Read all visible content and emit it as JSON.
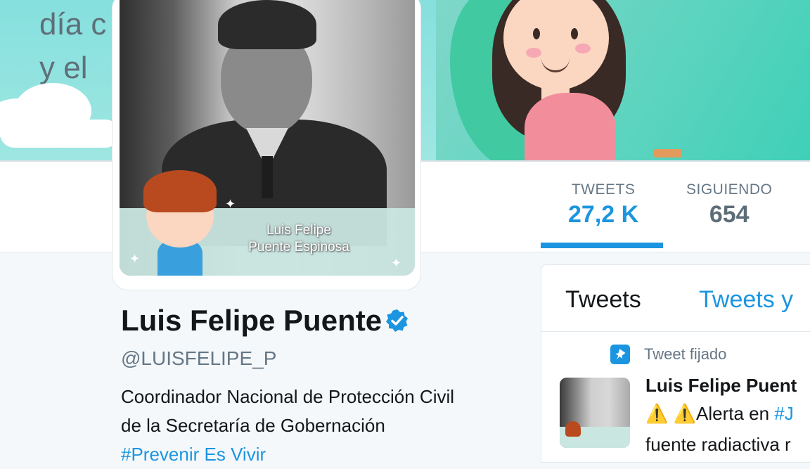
{
  "banner": {
    "text_line1": "día c",
    "text_line2": "y el"
  },
  "avatar": {
    "caption_line1": "Luis Felipe",
    "caption_line2": "Puente Espinosa"
  },
  "stats": [
    {
      "label": "TWEETS",
      "value": "27,2 K"
    },
    {
      "label": "SIGUIENDO",
      "value": "654"
    }
  ],
  "profile": {
    "name": "Luis Felipe Puente",
    "handle": "@LUISFELIPE_P",
    "bio_line1": "Coordinador Nacional de Protección Civil",
    "bio_line2": "de la Secretaría de Gobernación",
    "bio_line3": "#Prevenir Es Vivir"
  },
  "timeline": {
    "tabs": [
      "Tweets",
      "Tweets y"
    ],
    "pinned_label": "Tweet fijado",
    "tweet": {
      "author": "Luis Felipe Puent",
      "line1_prefix": "⚠️ ⚠️",
      "line1_text": "Alerta en ",
      "line1_link": "#J",
      "line2": "fuente radiactiva r"
    }
  },
  "colors": {
    "accent": "#1b95e0",
    "muted": "#657786",
    "text": "#14171a"
  }
}
